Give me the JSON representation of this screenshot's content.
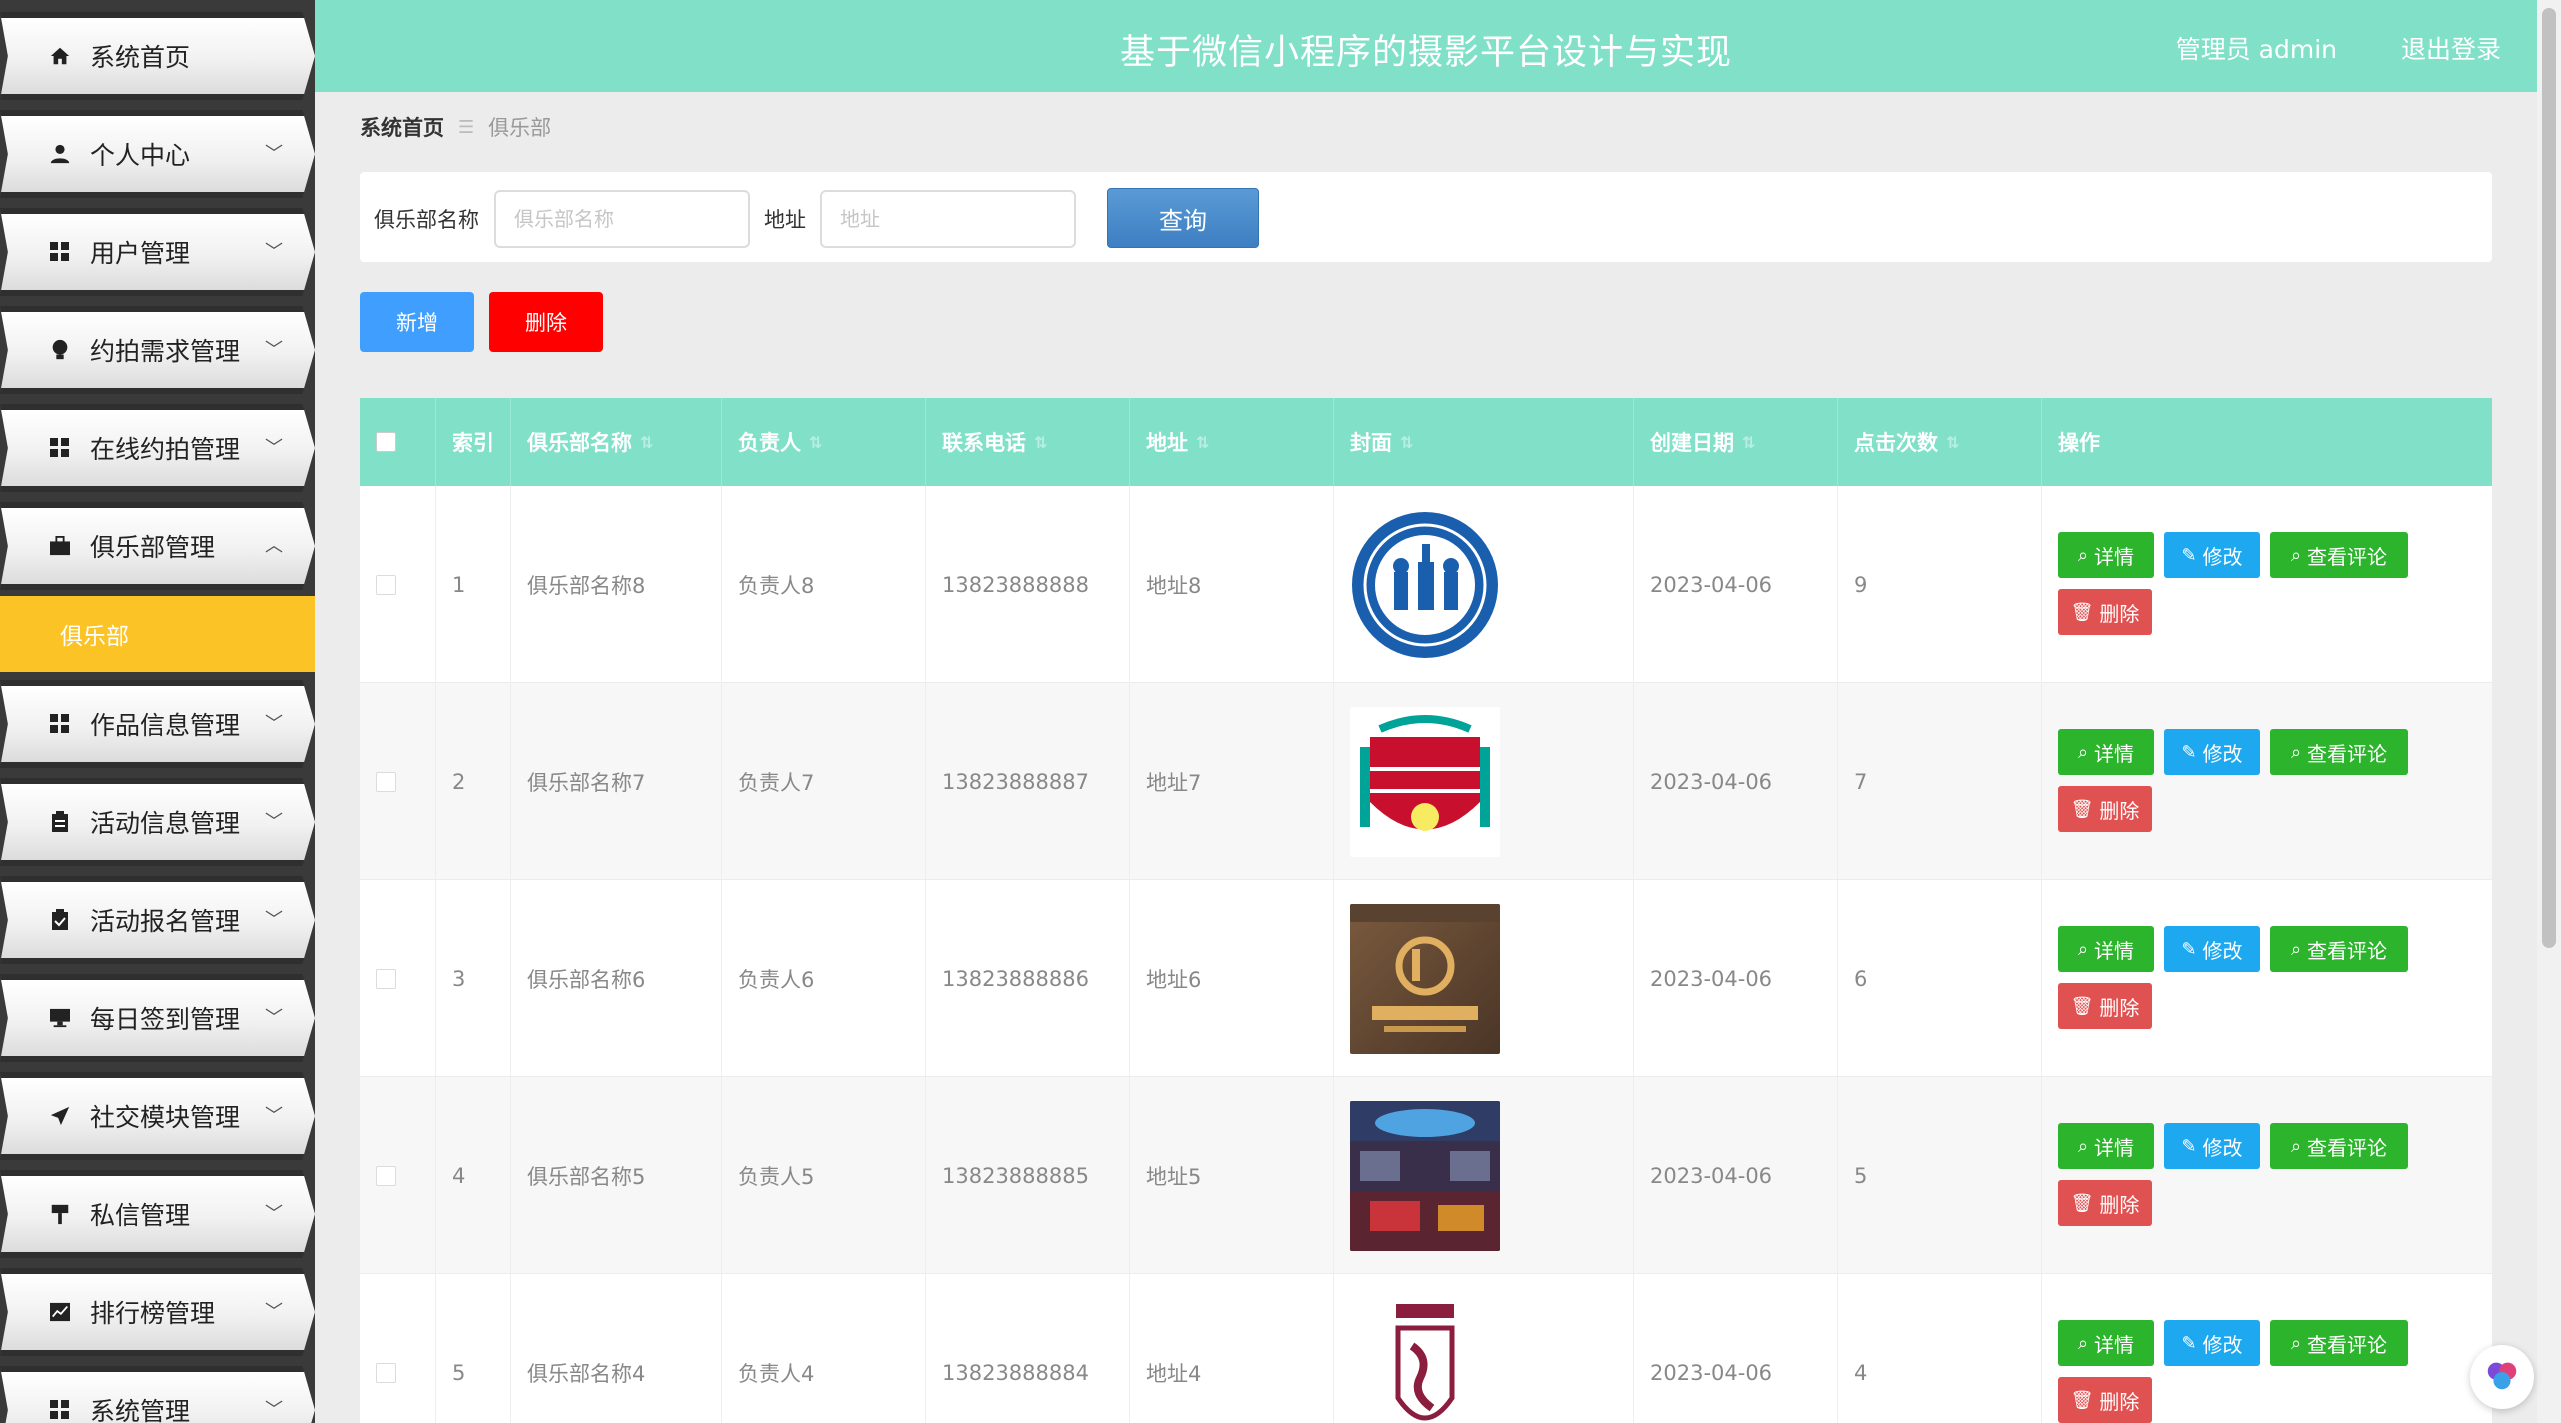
{
  "app": {
    "title": "基于微信小程序的摄影平台设计与实现",
    "user_label": "管理员 admin",
    "logout_label": "退出登录"
  },
  "sidebar": {
    "items": [
      {
        "label": "系统首页",
        "icon": "home-icon",
        "has_arrow": false
      },
      {
        "label": "个人中心",
        "icon": "user-icon",
        "has_arrow": true
      },
      {
        "label": "用户管理",
        "icon": "grid-icon",
        "has_arrow": true
      },
      {
        "label": "约拍需求管理",
        "icon": "bulb-icon",
        "has_arrow": true
      },
      {
        "label": "在线约拍管理",
        "icon": "grid-icon",
        "has_arrow": true
      },
      {
        "label": "俱乐部管理",
        "icon": "briefcase-icon",
        "has_arrow": true,
        "expanded": true
      },
      {
        "label": "作品信息管理",
        "icon": "grid-icon",
        "has_arrow": true
      },
      {
        "label": "活动信息管理",
        "icon": "clipboard-icon",
        "has_arrow": true
      },
      {
        "label": "活动报名管理",
        "icon": "clipboard-check-icon",
        "has_arrow": true
      },
      {
        "label": "每日签到管理",
        "icon": "monitor-icon",
        "has_arrow": true
      },
      {
        "label": "社交模块管理",
        "icon": "send-icon",
        "has_arrow": true
      },
      {
        "label": "私信管理",
        "icon": "signpost-icon",
        "has_arrow": true
      },
      {
        "label": "排行榜管理",
        "icon": "chart-icon",
        "has_arrow": true
      },
      {
        "label": "系统管理",
        "icon": "grid-icon",
        "has_arrow": true
      }
    ],
    "sub_item": "俱乐部",
    "colors": {
      "active_sub": "#fcc326"
    }
  },
  "breadcrumb": {
    "home": "系统首页",
    "current": "俱乐部"
  },
  "search": {
    "name_label": "俱乐部名称",
    "name_placeholder": "俱乐部名称",
    "address_label": "地址",
    "address_placeholder": "地址",
    "query_label": "查询"
  },
  "actions": {
    "add_label": "新增",
    "delete_label": "删除"
  },
  "table": {
    "headers": {
      "index": "索引",
      "name": "俱乐部名称",
      "owner": "负责人",
      "phone": "联系电话",
      "address": "地址",
      "cover": "封面",
      "date": "创建日期",
      "clicks": "点击次数",
      "ops": "操作"
    },
    "rows": [
      {
        "index": "1",
        "name": "俱乐部名称8",
        "owner": "负责人8",
        "phone": "13823888888",
        "address": "地址8",
        "date": "2023-04-06",
        "clicks": "9"
      },
      {
        "index": "2",
        "name": "俱乐部名称7",
        "owner": "负责人7",
        "phone": "13823888887",
        "address": "地址7",
        "date": "2023-04-06",
        "clicks": "7"
      },
      {
        "index": "3",
        "name": "俱乐部名称6",
        "owner": "负责人6",
        "phone": "13823888886",
        "address": "地址6",
        "date": "2023-04-06",
        "clicks": "6"
      },
      {
        "index": "4",
        "name": "俱乐部名称5",
        "owner": "负责人5",
        "phone": "13823888885",
        "address": "地址5",
        "date": "2023-04-06",
        "clicks": "5"
      },
      {
        "index": "5",
        "name": "俱乐部名称4",
        "owner": "负责人4",
        "phone": "13823888884",
        "address": "地址4",
        "date": "2023-04-06",
        "clicks": "4"
      }
    ],
    "ops": {
      "detail": "详情",
      "edit": "修改",
      "comments": "查看评论",
      "delete": "删除"
    }
  },
  "colors": {
    "header": "#80e0c8",
    "primary": "#409eff",
    "danger": "#ff0000",
    "success": "#2cb52c",
    "info": "#1ea8f0"
  }
}
